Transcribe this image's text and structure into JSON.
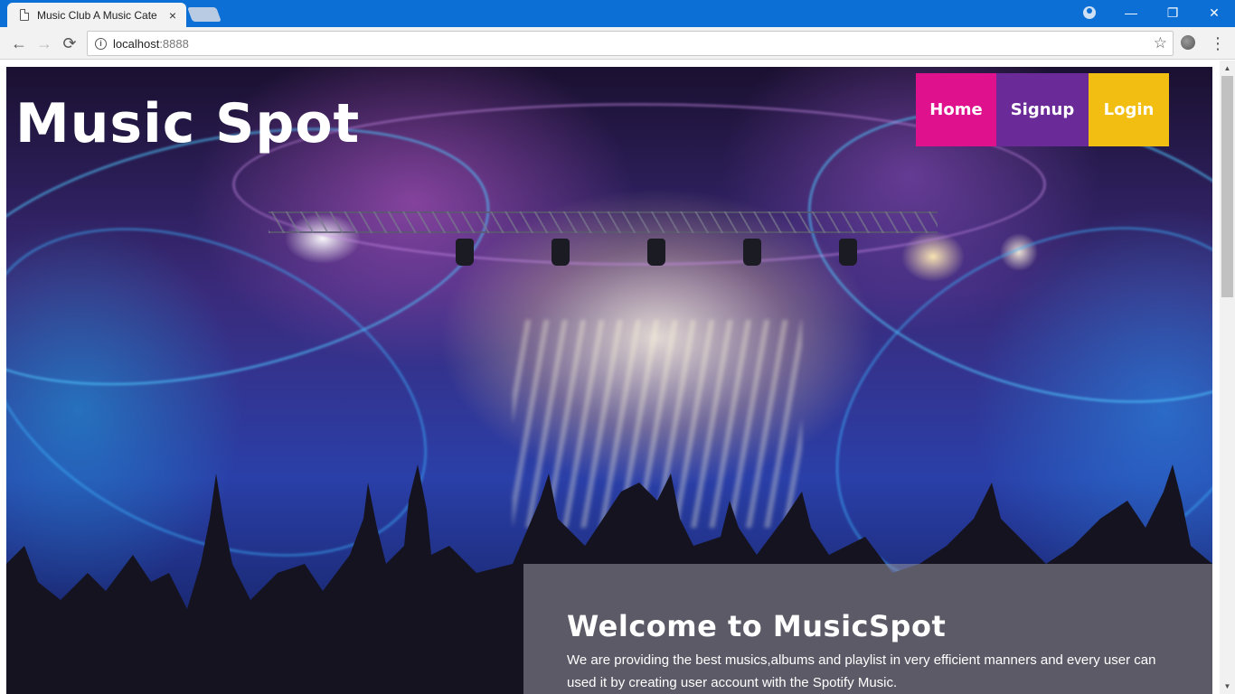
{
  "browser": {
    "tab_title": "Music Club A Music Cate",
    "tab_close": "×",
    "url_host": "localhost",
    "url_port": ":8888",
    "back_glyph": "←",
    "forward_glyph": "→",
    "reload_glyph": "⟳",
    "star_glyph": "☆",
    "menu_glyph": "⋮",
    "minimize_glyph": "—",
    "restore_glyph": "❐",
    "close_glyph": "✕",
    "info_glyph": "i"
  },
  "site": {
    "logo": "Music Spot",
    "nav": [
      {
        "label": "Home",
        "color": "#e0118c"
      },
      {
        "label": "Signup",
        "color": "#6a2a97"
      },
      {
        "label": "Login",
        "color": "#f3be12"
      }
    ],
    "welcome_title": "Welcome to MusicSpot",
    "welcome_text": "We are providing the best musics,albums and playlist in very efficient manners and every user can used it by creating user account with the Spotify Music."
  },
  "scrollbar": {
    "up_glyph": "▲",
    "down_glyph": "▼"
  },
  "colors": {
    "titlebar": "#0b6fd6",
    "toolbar": "#f2f2f2"
  }
}
